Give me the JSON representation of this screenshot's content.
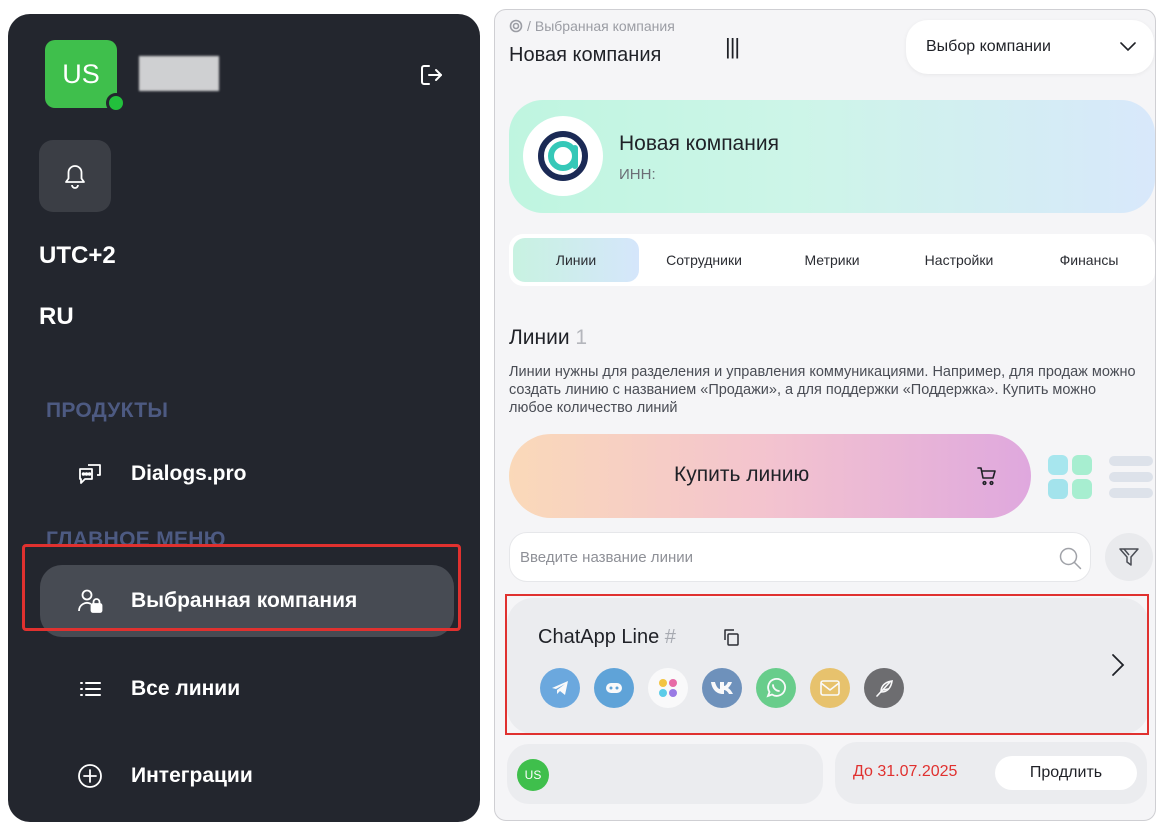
{
  "user": {
    "initials": "US",
    "status_color": "#22c03c"
  },
  "sidebar": {
    "timezone": "UTC+2",
    "language": "RU",
    "products_title": "ПРОДУКТЫ",
    "products": [
      {
        "label": "Dialogs.pro",
        "icon": "chat-dots-icon"
      }
    ],
    "menu_title": "ГЛАВНОЕ МЕНЮ",
    "menu": [
      {
        "label": "Выбранная компания",
        "icon": "user-lock-icon",
        "active": true
      },
      {
        "label": "Все линии",
        "icon": "list-icon"
      },
      {
        "label": "Интеграции",
        "icon": "plus-circle-icon"
      }
    ]
  },
  "header": {
    "breadcrumb": "Выбранная компания",
    "breadcrumb_sep": "/",
    "title": "Новая компания",
    "drag_handle": "|||",
    "company_select": "Выбор компании"
  },
  "company": {
    "name": "Новая компания",
    "inn_label": "ИНН:"
  },
  "tabs": [
    {
      "label": "Линии",
      "active": true
    },
    {
      "label": "Сотрудники"
    },
    {
      "label": "Метрики"
    },
    {
      "label": "Настройки"
    },
    {
      "label": "Финансы"
    }
  ],
  "lines": {
    "title": "Линии",
    "count": "1",
    "description": "Линии нужны для разделения и управления коммуникациями. Например, для продаж можно создать линию с названием «Продажи», а для поддержки «Поддержка». Купить можно любое количество линий",
    "buy_label": "Купить линию",
    "search_placeholder": "Введите название линии"
  },
  "line_card": {
    "name": "ChatApp Line",
    "hash": "#",
    "messengers": [
      {
        "icon": "telegram-icon",
        "color": "#3b8fd8"
      },
      {
        "icon": "telegram-bot-icon",
        "color": "#2a87d0"
      },
      {
        "icon": "multi-dots-icon",
        "color": "#ffffff"
      },
      {
        "icon": "vk-icon",
        "color": "#3f6fa8"
      },
      {
        "icon": "whatsapp-icon",
        "color": "#36c266"
      },
      {
        "icon": "email-icon",
        "color": "#e6b23c"
      },
      {
        "icon": "feather-icon",
        "color": "#3d3d40"
      }
    ]
  },
  "subscription": {
    "avatar_initials": "US",
    "expires": "До 31.07.2025",
    "extend_label": "Продлить"
  },
  "colors": {
    "accent_red": "#e0312f",
    "sidebar_bg": "#23262e",
    "green": "#3fbf4c"
  }
}
